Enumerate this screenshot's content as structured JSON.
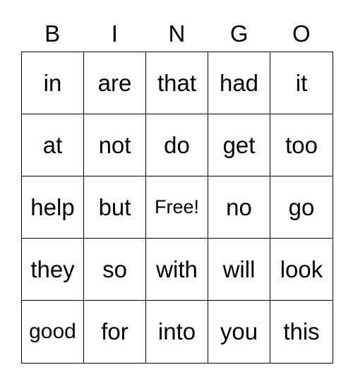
{
  "header": [
    "B",
    "I",
    "N",
    "G",
    "O"
  ],
  "rows": [
    [
      "in",
      "are",
      "that",
      "had",
      "it"
    ],
    [
      "at",
      "not",
      "do",
      "get",
      "too"
    ],
    [
      "help",
      "but",
      "Free!",
      "no",
      "go"
    ],
    [
      "they",
      "so",
      "with",
      "will",
      "look"
    ],
    [
      "good",
      "for",
      "into",
      "you",
      "this"
    ]
  ]
}
